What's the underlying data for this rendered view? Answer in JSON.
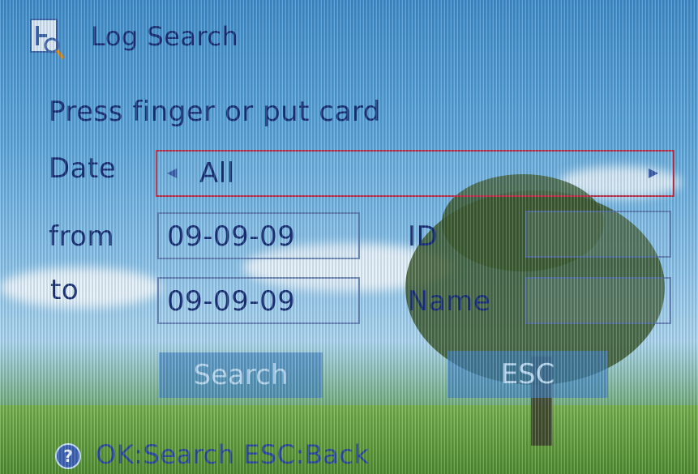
{
  "header": {
    "title": "Log Search",
    "icon": "log-search-icon"
  },
  "prompt": "Press finger or put card",
  "date": {
    "label": "Date",
    "value": "All"
  },
  "from": {
    "label": "from",
    "value": "09-09-09"
  },
  "to": {
    "label": "to",
    "value": "09-09-09"
  },
  "id_field": {
    "label": "ID",
    "value": ""
  },
  "name_field": {
    "label": "Name",
    "value": ""
  },
  "buttons": {
    "search": "Search",
    "esc": "ESC"
  },
  "footer": {
    "help_icon_glyph": "?",
    "hint": "OK:Search ESC:Back"
  },
  "colors": {
    "text": "#17307a",
    "field_border": "#c0304a",
    "button_bg": "#3c82c8"
  }
}
